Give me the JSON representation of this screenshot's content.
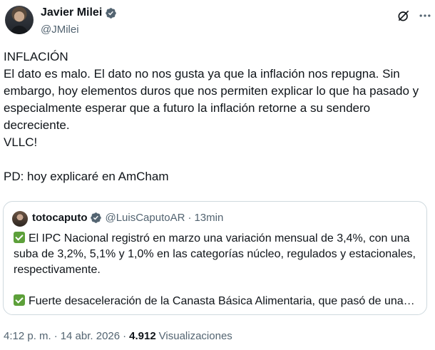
{
  "author": {
    "display_name": "Javier Milei",
    "handle": "@JMilei"
  },
  "tweet": {
    "lines": [
      "INFLACIÓN",
      "El dato es malo. El dato no nos gusta ya que la inflación nos repugna. Sin embargo, hoy elementos duros que nos permiten explicar lo que ha pasado y especialmente esperar que a futuro la inflación retorne a su sendero decreciente.",
      "VLLC!",
      "PD: hoy explicaré en AmCham"
    ]
  },
  "quote": {
    "display_name": "totocaputo",
    "handle": "@LuisCaputoAR",
    "separator": "·",
    "time": "13min",
    "paragraph_1": "El IPC Nacional registró en marzo una variación mensual de 3,4%, con una suba de 3,2%, 5,1% y 1,0% en las categorías núcleo, regulados y estacionales, respectivamente.",
    "paragraph_2": "Fuerte desaceleración de la Canasta Básica Alimentaria, que pasó de una…"
  },
  "meta": {
    "time": "4:12 p. m.",
    "separator": "·",
    "date": "14 abr. 2026",
    "separator2": "·",
    "views_count": "4.912",
    "views_label": "Visualizaciones"
  },
  "icons": {
    "verified": "verified-badge-icon",
    "grok": "grok-icon",
    "more": "more-icon",
    "check": "check-mark-icon"
  },
  "colors": {
    "verified": "#1d9bf0",
    "check": "#5da03a",
    "secondary_text": "#536471"
  }
}
